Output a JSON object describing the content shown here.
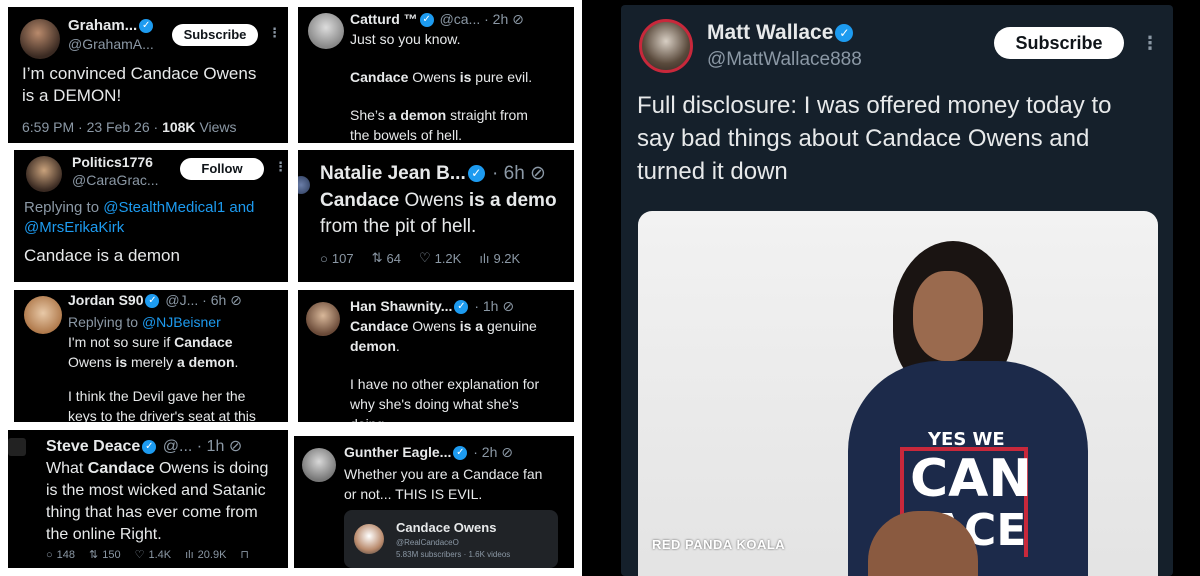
{
  "cards": {
    "graham": {
      "name": "Graham...",
      "handle": "@GrahamA...",
      "subscribe": "Subscribe",
      "text1": "I’m convinced Candace Owens",
      "text2": "is a DEMON!",
      "meta": "6:59 PM · 23 Feb 26 ·",
      "views_count": "108K",
      "views_label": "Views"
    },
    "catturd": {
      "name": "Catturd ™",
      "handle": "@ca...",
      "time": "· 2h",
      "line1": "Just so you know.",
      "line2_bold1": "Candace",
      "line2_mid": " Owens ",
      "line2_bold2": "is",
      "line2_end": " pure evil.",
      "line3_pre": "She’s ",
      "line3_bold": "a demon",
      "line3_end": " straight from",
      "line4": "the bowels of hell."
    },
    "politics": {
      "name": "Politics1776",
      "handle": "@CaraGrac...",
      "follow": "Follow",
      "replying": "Replying to",
      "reply1": "@StealthMedical1",
      "and": "and",
      "reply2": "@MrsErikaKirk",
      "text": "Candace is a demon"
    },
    "natalie": {
      "name": "Natalie Jean B...",
      "time": "· 6h",
      "line1_bold1": "Candace",
      "line1_mid": " Owens ",
      "line1_bold2": "is a demo",
      "line2": "from the pit of hell.",
      "replies": "107",
      "reposts": "64",
      "likes": "1.2K",
      "views": "9.2K"
    },
    "jordan": {
      "name": "Jordan S90",
      "handle": "@J...",
      "time": "· 6h",
      "replying": "Replying to",
      "reply_to": "@NJBeisner",
      "line1_pre": "I'm not so sure if ",
      "line1_bold": "Candace",
      "line2_pre": "Owens ",
      "line2_bold1": "is",
      "line2_mid": " merely ",
      "line2_bold2": "a demon",
      "line2_end": ".",
      "line3": "I think the Devil gave her the",
      "line4": "keys to the driver's seat at this"
    },
    "han": {
      "name": "Han Shawnity...",
      "time": "· 1h",
      "line1_bold1": "Candace",
      "line1_mid": " Owens ",
      "line1_bold2": "is a",
      "line1_end": " genuine",
      "line2_bold": "demon",
      "line2_end": ".",
      "line3": "I have no other explanation for",
      "line4": "why she's doing what she's",
      "line5": "doing"
    },
    "steve": {
      "name": "Steve Deace",
      "handle": "@...",
      "time": "· 1h",
      "line1_pre": "What ",
      "line1_bold": "Candace",
      "line1_end": " Owens is doing",
      "line2": "is the most wicked and Satanic",
      "line3": "thing that has ever come from",
      "line4": "the online Right.",
      "replies": "148",
      "reposts": "150",
      "likes": "1.4K",
      "views": "20.9K"
    },
    "gunther": {
      "name": "Gunther Eagle...",
      "time": "· 2h",
      "line1_pre": "Whether you are a ",
      "line1_hl": "Candace",
      "line1_end": " fan",
      "line2": "or not... THIS IS EVIL.",
      "embed_name": "Candace Owens",
      "embed_handle": "@RealCandaceO",
      "embed_meta": "5.83M subscribers · 1.6K videos"
    }
  },
  "main_post": {
    "name": "Matt Wallace",
    "handle": "@MattWallace888",
    "subscribe": "Subscribe",
    "text1": "Full disclosure: I was offered money today to",
    "text2": "say bad things about Candace Owens and",
    "text3": "turned it down",
    "sweater_line1": "YES WE",
    "sweater_line2": "CAN",
    "sweater_line3": "ACE",
    "watermark": "RED PANDA KOALA"
  }
}
